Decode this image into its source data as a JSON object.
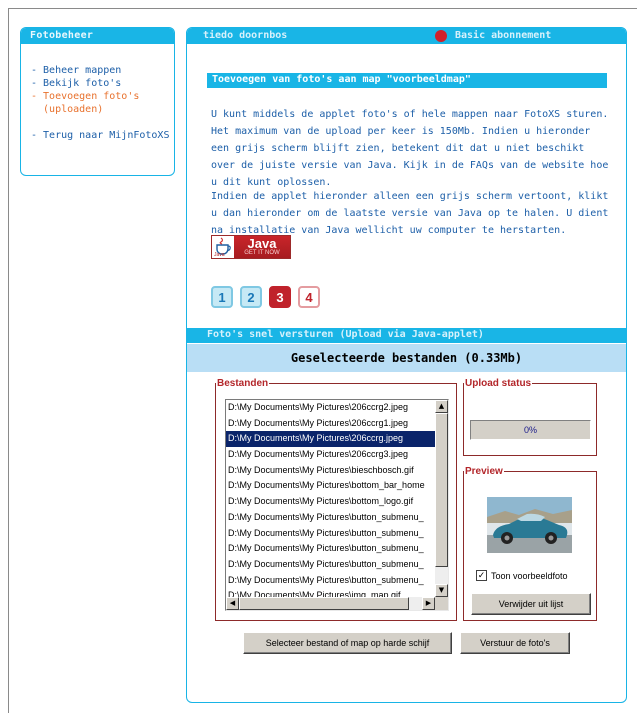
{
  "sidebar": {
    "title": "Fotobeheer",
    "items": [
      {
        "label": "- Beheer mappen"
      },
      {
        "label": "- Bekijk foto's"
      },
      {
        "label": "- Toevoegen foto's"
      },
      {
        "label": "  (uploaden)"
      },
      {
        "label": "- Terug naar MijnFotoXS"
      }
    ]
  },
  "header": {
    "user": "tiedo doornbos",
    "subscription": "Basic abonnement",
    "status_color": "#d0202a"
  },
  "section": {
    "title": "Toevoegen van foto's aan map \"voorbeeldmap\""
  },
  "intro": {
    "paragraph1": "U kunt middels de applet foto's of hele mappen naar FotoXS sturen. Het maximum van de upload per keer is 150Mb. Indien u hieronder een grijs scherm blijft zien, betekent dit dat u niet beschikt over de juiste versie van Java. Kijk in de FAQs van de website hoe u dit kunt oplossen.",
    "paragraph2": "Indien de applet hieronder alleen een grijs scherm vertoont, klikt u dan hieronder om de laatste versie van Java op te halen. U dient na installatie van Java wellicht uw computer te herstarten."
  },
  "java_badge": {
    "brand": "Java",
    "tagline": "GET IT NOW",
    "small": "Java"
  },
  "steps": [
    "1",
    "2",
    "3",
    "4"
  ],
  "applet": {
    "title": "Foto's snel versturen (Upload via Java-applet)",
    "selected_summary": "Geselecteerde bestanden (0.33Mb)",
    "files_legend": "Bestanden",
    "upload_legend": "Upload status",
    "preview_legend": "Preview",
    "progress_percent": 0,
    "progress_text": "0%",
    "files": [
      "D:\\My Documents\\My Pictures\\206ccrg2.jpeg",
      "D:\\My Documents\\My Pictures\\206ccrg1.jpeg",
      "D:\\My Documents\\My Pictures\\206ccrg.jpeg",
      "D:\\My Documents\\My Pictures\\206ccrg3.jpeg",
      "D:\\My Documents\\My Pictures\\bieschbosch.gif",
      "D:\\My Documents\\My Pictures\\bottom_bar_home",
      "D:\\My Documents\\My Pictures\\bottom_logo.gif",
      "D:\\My Documents\\My Pictures\\button_submenu_",
      "D:\\My Documents\\My Pictures\\button_submenu_",
      "D:\\My Documents\\My Pictures\\button_submenu_",
      "D:\\My Documents\\My Pictures\\button_submenu_",
      "D:\\My Documents\\My Pictures\\button_submenu_",
      "D:\\My Documents\\My Pictures\\img_map.gif"
    ],
    "selected_index": 2,
    "show_preview_label": "Toon voorbeeldfoto",
    "show_preview_checked": true,
    "remove_button": "Verwijder uit lijst",
    "select_button": "Selecteer bestand of map op harde schijf",
    "send_button": "Verstuur de foto's"
  }
}
